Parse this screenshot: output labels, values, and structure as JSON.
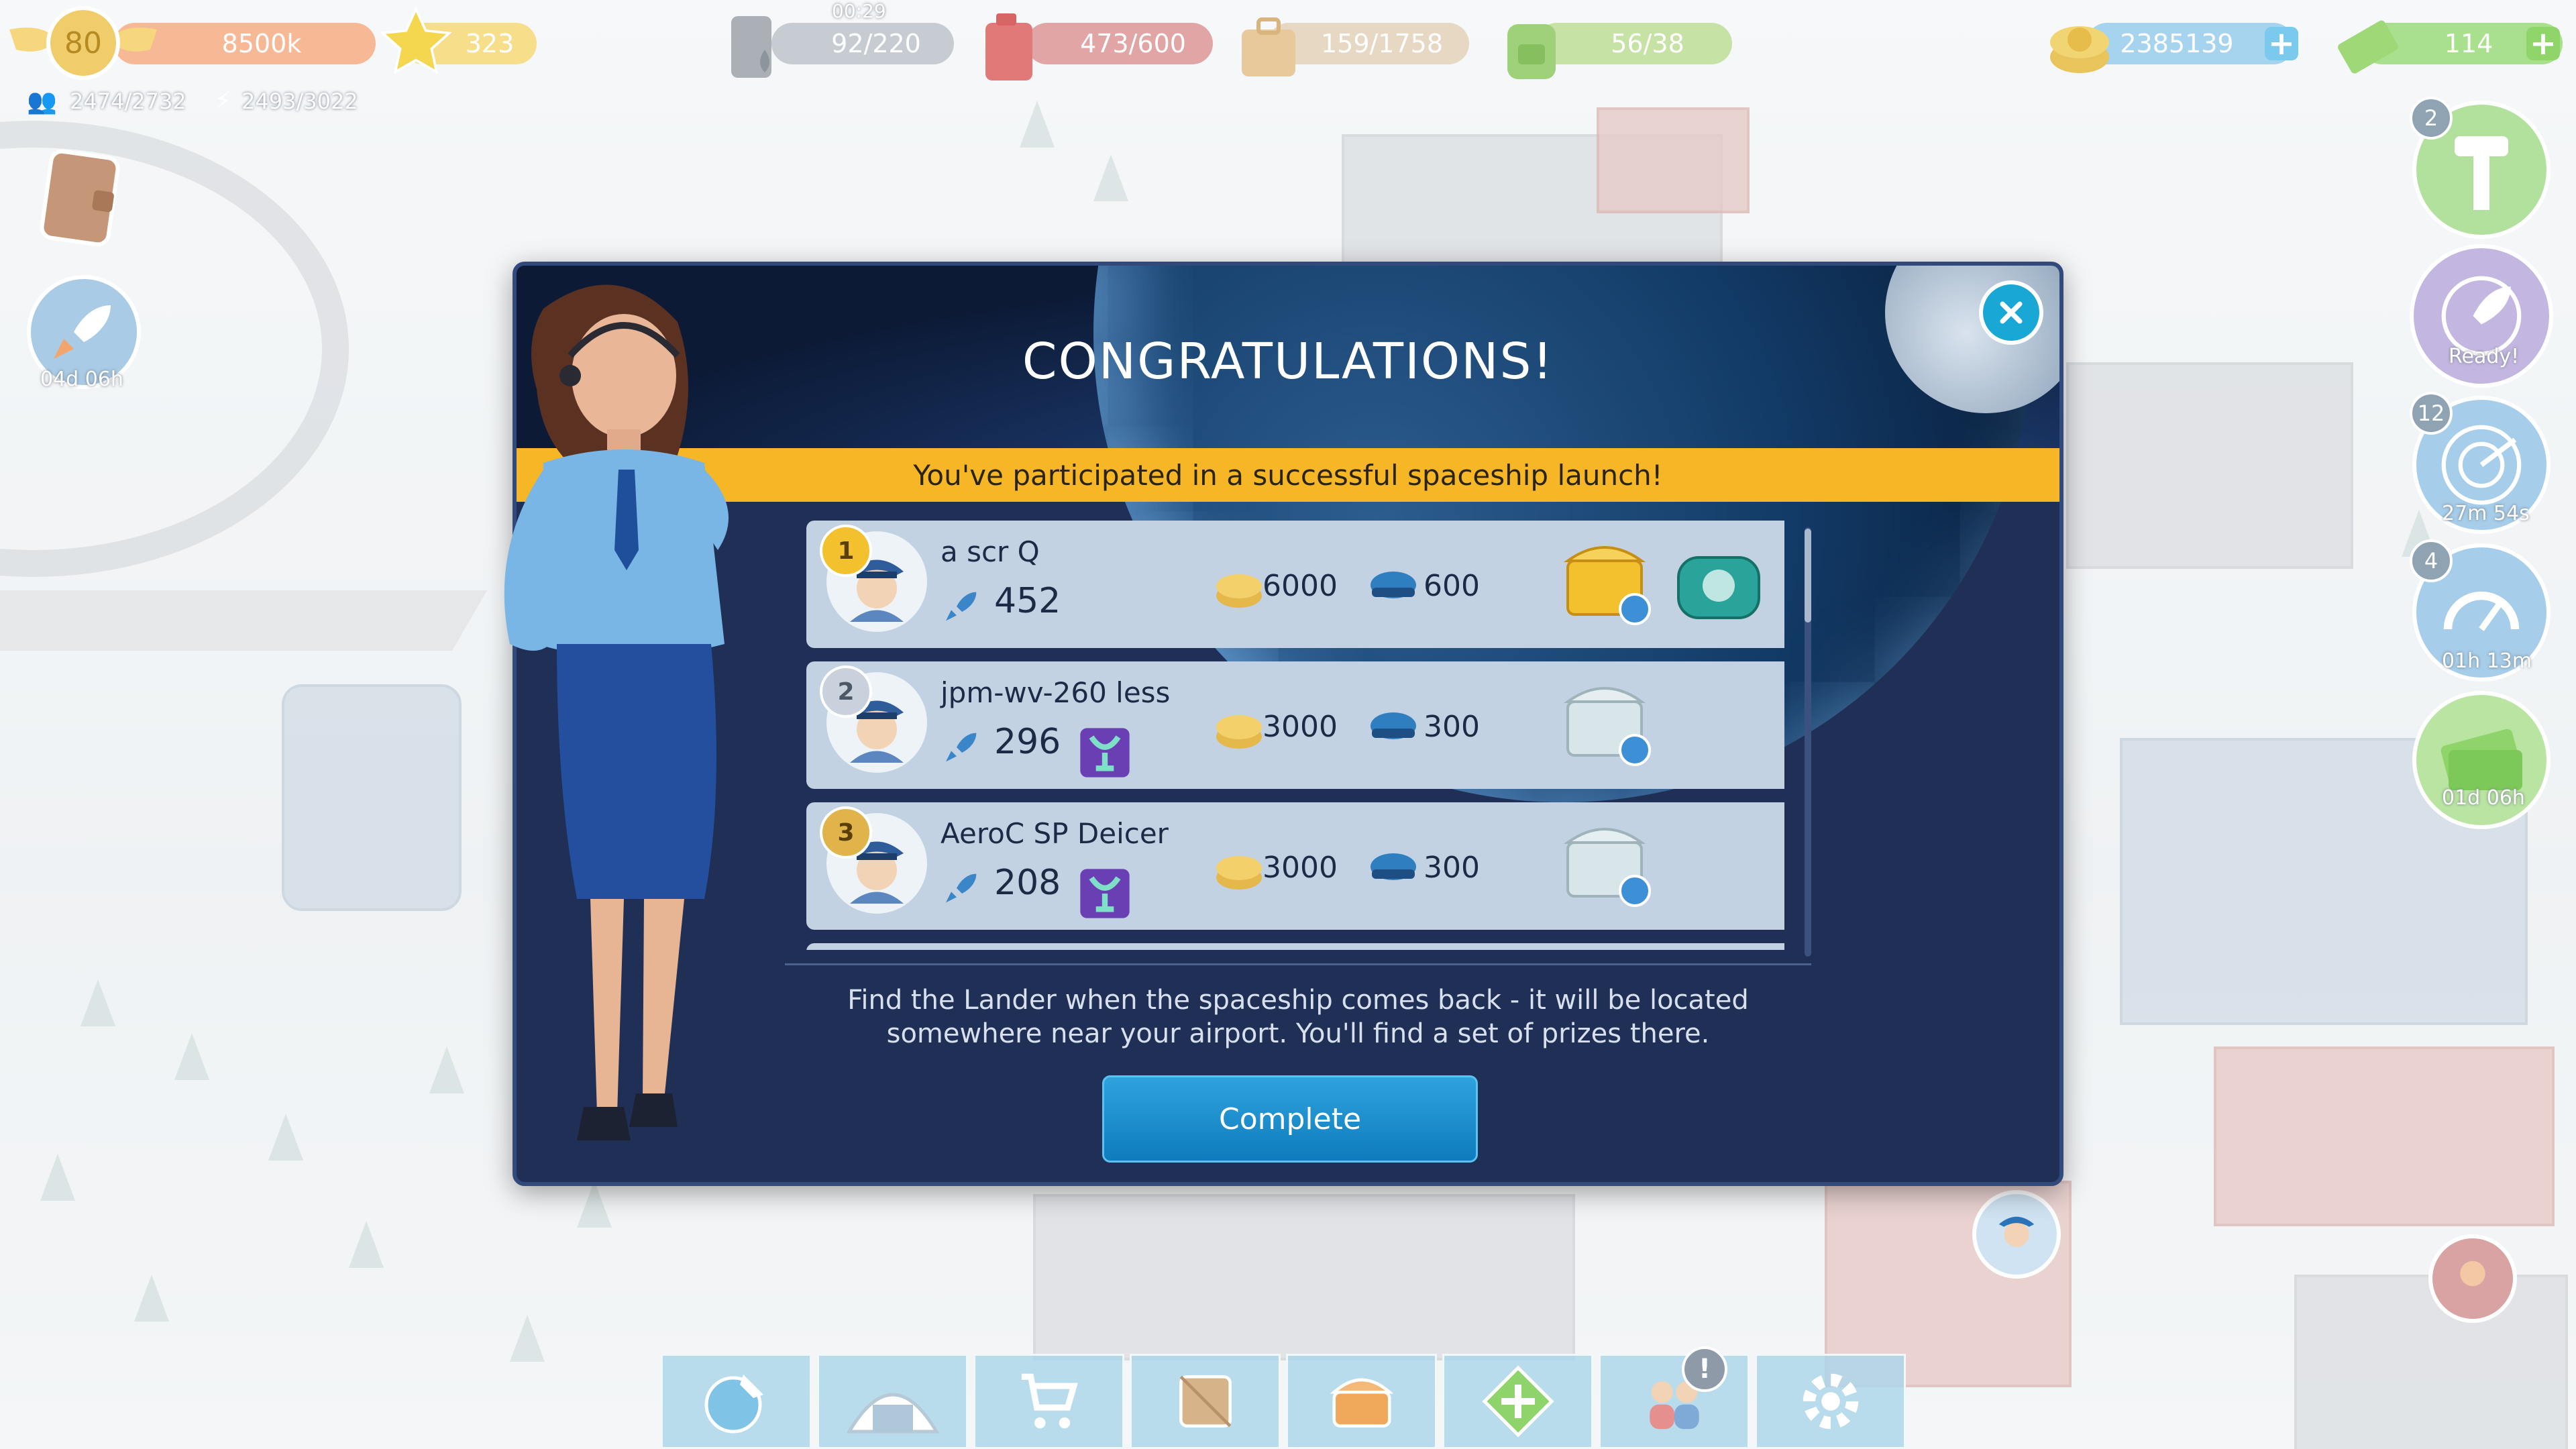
{
  "hud": {
    "level": "80",
    "xp": "8500k",
    "stars": "323",
    "passengers": "2474/2732",
    "power": "2493/3022",
    "fuel_timer": "00:29",
    "fuel": "92/220",
    "gas": "473/600",
    "cargo": "159/1758",
    "staff_bag": "56/38",
    "coins": "2385139",
    "cash": "114"
  },
  "left_side": {
    "rocket_timer": "04d 06h"
  },
  "right_side": {
    "tower_badge": "2",
    "ready_label": "Ready!",
    "radar_badge": "12",
    "radar_timer": "27m 54s",
    "gauge_badge": "4",
    "gauge_timer": "01h 13m",
    "money_timer": "01d 06h"
  },
  "modal": {
    "title": "CONGRATULATIONS!",
    "banner": "You've participated in a successful spaceship launch!",
    "description_line1": "Find the Lander when the spaceship comes back - it will be located",
    "description_line2": "somewhere near your airport. You'll find a set of prizes there.",
    "complete_label": "Complete"
  },
  "leaderboard": [
    {
      "rank": "1",
      "name": "a scr Q",
      "score": "452",
      "coins": "6000",
      "hats": "600",
      "has_cup": false,
      "prizes": [
        "gold-chest-icon",
        "teal-capsule-icon"
      ]
    },
    {
      "rank": "2",
      "name": "jpm-wv-260 less",
      "score": "296",
      "coins": "3000",
      "hats": "300",
      "has_cup": true,
      "prizes": [
        "silver-chest-icon"
      ]
    },
    {
      "rank": "3",
      "name": "AeroC SP Deicer",
      "score": "208",
      "coins": "3000",
      "hats": "300",
      "has_cup": true,
      "prizes": [
        "silver-chest-icon"
      ]
    }
  ],
  "toolbar": [
    "globe-plane-icon",
    "hangar-icon",
    "shop-cart-icon",
    "crate-icon",
    "treasure-chest-icon",
    "expand-map-icon",
    "people-icon",
    "settings-gear-icon"
  ],
  "colors": {
    "gold": "#f7b626",
    "modal": "#1f2f56",
    "row": "#c3d2e3",
    "button": "#1a8fcf"
  }
}
